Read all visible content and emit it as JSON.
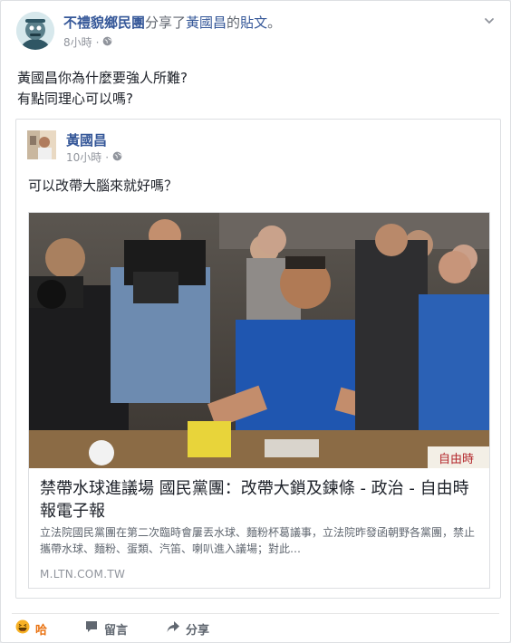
{
  "post": {
    "author": "不禮貌鄉民團",
    "shared_text": "分享了",
    "original_author": "黃國昌",
    "possessive": "的",
    "post_link": "貼文",
    "suffix": "。",
    "time": "8小時",
    "separator": "·",
    "text_line1": "黃國昌你為什麼要強人所難?",
    "text_line2": "有點同理心可以嗎?"
  },
  "shared_post": {
    "author": "黃國昌",
    "time": "10小時",
    "separator": "·",
    "text": "可以改帶大腦來就好嗎？"
  },
  "link_card": {
    "title": "禁帶水球進議場 國民黨團：改帶大鎖及鍊條 - 政治 - 自由時報電子報",
    "description": "立法院國民黨團在第二次臨時會屢丟水球、麵粉杯葛議事，立法院昨發函朝野各黨團，禁止攜帶水球、麵粉、蛋類、汽笛、喇叭進入議場；對此…",
    "domain": "M.LTN.COM.TW",
    "watermark": "自由時"
  },
  "actions": {
    "like": "哈",
    "comment": "留言",
    "share": "分享"
  },
  "icons": {
    "privacy": "globe-icon",
    "menu": "chevron-down-icon",
    "like": "haha-reaction-icon",
    "comment": "comment-icon",
    "share": "share-arrow-icon"
  },
  "colors": {
    "link": "#365899",
    "meta": "#90949c",
    "haha": "#f7b125"
  }
}
